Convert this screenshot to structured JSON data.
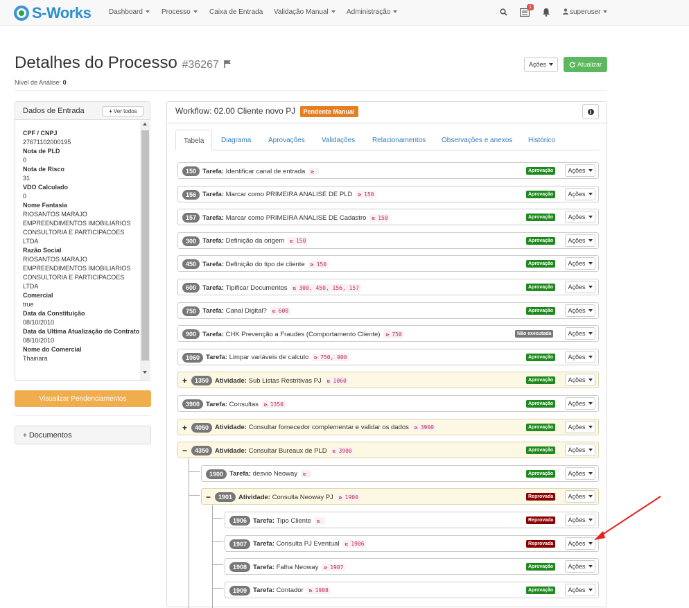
{
  "navbar": {
    "brand": "S-Works",
    "menu": [
      {
        "label": "Dashboard",
        "dropdown": true
      },
      {
        "label": "Processo",
        "dropdown": true
      },
      {
        "label": "Caixa de Entrada",
        "dropdown": false
      },
      {
        "label": "Validação Manual",
        "dropdown": true
      },
      {
        "label": "Administração",
        "dropdown": true
      }
    ],
    "notification_count": "1",
    "user": "superuser"
  },
  "header": {
    "title": "Detalhes do Processo",
    "process_number": "#36267",
    "analysis_label": "Nível de Análise:",
    "analysis_value": "0",
    "actions_button": "Ações",
    "refresh_button": "Atualizar"
  },
  "input_data": {
    "title": "Dados de Entrada",
    "view_all": "Ver todos",
    "fields": [
      {
        "label": "CPF / CNPJ",
        "value": "27671102000195"
      },
      {
        "label": "Nota de PLD",
        "value": "0"
      },
      {
        "label": "Nota de Risco",
        "value": "31"
      },
      {
        "label": "VDO Calculado",
        "value": "0"
      },
      {
        "label": "Nome Fantasia",
        "value": "RIOSANTOS MARAJO EMPREENDIMENTOS IMOBILIARIOS CONSULTORIA E PARTICIPACOES LTDA"
      },
      {
        "label": "Razão Social",
        "value": "RIOSANTOS MARAJO EMPREENDIMENTOS IMOBILIARIOS CONSULTORIA E PARTICIPACOES LTDA"
      },
      {
        "label": "Comercial",
        "value": "true"
      },
      {
        "label": "Data da Constituição",
        "value": "08/10/2010"
      },
      {
        "label": "Data da Ultima Atualização do Contrato",
        "value": "08/10/2010"
      },
      {
        "label": "Nome do Comercial",
        "value": "Thainara"
      }
    ]
  },
  "pending_button": "Visualizar Pendenciamentos",
  "documents_panel": "Documentos",
  "workflow": {
    "title": "Workflow: 02.00 Cliente novo PJ",
    "status": "Pendente Manual",
    "tabs": [
      "Tabela",
      "Diagrama",
      "Aprovações",
      "Validações",
      "Relacionamentos",
      "Observações e anexos",
      "Histórico"
    ],
    "active_tab": "Tabela",
    "rows": [
      {
        "id": "150",
        "kind": "Tarefa",
        "name": "Identificar canal de entrada",
        "deps": "",
        "status": "Aprovação",
        "level": 0,
        "activity": false
      },
      {
        "id": "156",
        "kind": "Tarefa",
        "name": "Marcar como PRIMEIRA ANALISE DE PLD",
        "deps": "150",
        "status": "Aprovação",
        "level": 0,
        "activity": false
      },
      {
        "id": "157",
        "kind": "Tarefa",
        "name": "Marcar como PRIMEIRA ANALISE DE Cadastro",
        "deps": "150",
        "status": "Aprovação",
        "level": 0,
        "activity": false
      },
      {
        "id": "300",
        "kind": "Tarefa",
        "name": "Definição da origem",
        "deps": "150",
        "status": "Aprovação",
        "level": 0,
        "activity": false
      },
      {
        "id": "450",
        "kind": "Tarefa",
        "name": "Definição do tipo de cliente",
        "deps": "150",
        "status": "Aprovação",
        "level": 0,
        "activity": false
      },
      {
        "id": "600",
        "kind": "Tarefa",
        "name": "Tipificar Documentos",
        "deps": "300, 450, 156, 157",
        "status": "Aprovação",
        "level": 0,
        "activity": false
      },
      {
        "id": "750",
        "kind": "Tarefa",
        "name": "Canal Digital?",
        "deps": "600",
        "status": "Aprovação",
        "level": 0,
        "activity": false
      },
      {
        "id": "900",
        "kind": "Tarefa",
        "name": "CHK Prevenção a Fraudes (Comportamento Cliente)",
        "deps": "750",
        "status": "Não executada",
        "level": 0,
        "activity": false
      },
      {
        "id": "1060",
        "kind": "Tarefa",
        "name": "Limpar variáveis de calculo",
        "deps": "750, 900",
        "status": "Aprovação",
        "level": 0,
        "activity": false
      },
      {
        "id": "1350",
        "kind": "Atividade",
        "name": "Sub Listas Restritivas PJ",
        "deps": "1060",
        "status": "Aprovação",
        "level": 0,
        "activity": true,
        "toggle": "+"
      },
      {
        "id": "3900",
        "kind": "Tarefa",
        "name": "Consultas",
        "deps": "1350",
        "status": "Aprovação",
        "level": 0,
        "activity": false
      },
      {
        "id": "4050",
        "kind": "Atividade",
        "name": "Consultar fornecedor complementar e validar os dados",
        "deps": "3900",
        "status": "Aprovação",
        "level": 0,
        "activity": true,
        "toggle": "+"
      },
      {
        "id": "4350",
        "kind": "Atividade",
        "name": "Consultar Bureaux de PLD",
        "deps": "3900",
        "status": "Aprovação",
        "level": 0,
        "activity": true,
        "toggle": "−"
      },
      {
        "id": "1900",
        "kind": "Tarefa",
        "name": "desvio Neoway",
        "deps": "",
        "status": "Aprovação",
        "level": 1,
        "activity": false
      },
      {
        "id": "1901",
        "kind": "Atividade",
        "name": "Consulta Neoway PJ",
        "deps": "1900",
        "status": "Reprovada",
        "level": 1,
        "activity": true,
        "toggle": "−"
      },
      {
        "id": "1906",
        "kind": "Tarefa",
        "name": "Tipo Cliente",
        "deps": "",
        "status": "Reprovada",
        "level": 2,
        "activity": false
      },
      {
        "id": "1907",
        "kind": "Tarefa",
        "name": "Consulta PJ Eventual",
        "deps": "1906",
        "status": "Reprovada",
        "level": 2,
        "activity": false
      },
      {
        "id": "1908",
        "kind": "Tarefa",
        "name": "Falha Neoway",
        "deps": "1907",
        "status": "Aprovação",
        "level": 2,
        "activity": false
      },
      {
        "id": "1909",
        "kind": "Tarefa",
        "name": "Contador",
        "deps": "1908",
        "status": "Aprovação",
        "level": 2,
        "activity": false
      }
    ],
    "row_actions_label": "Ações"
  },
  "colors": {
    "brand": "#2a8fd0",
    "approved": "#1e8a1e",
    "rejected": "#8b0000",
    "not_executed": "#777777",
    "pending": "#e67e22",
    "refresh": "#5cb85c",
    "pending_button": "#f0ad4e",
    "annotation_arrow": "#e8201e"
  }
}
